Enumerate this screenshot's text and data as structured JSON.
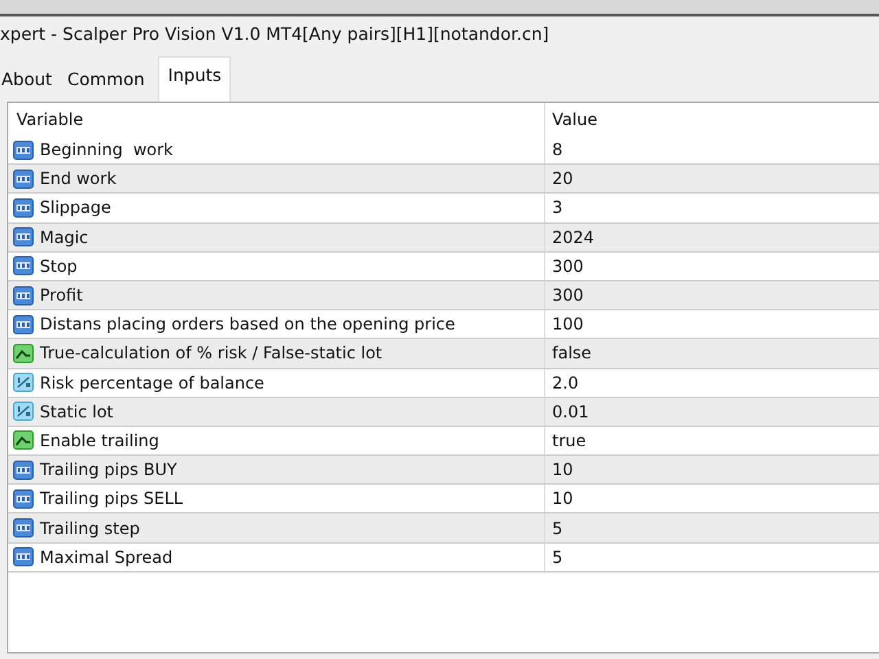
{
  "window": {
    "title": "xpert - Scalper Pro Vision V1.0 MT4[Any pairs][H1][notandor.cn]"
  },
  "tabs": [
    {
      "label": "About",
      "selected": false
    },
    {
      "label": "Common",
      "selected": false
    },
    {
      "label": "Inputs",
      "selected": true
    }
  ],
  "table": {
    "columns": [
      "Variable",
      "Value"
    ],
    "rows": [
      {
        "kind": "int",
        "variable": "Beginning  work",
        "value": "8"
      },
      {
        "kind": "int",
        "variable": "End work",
        "value": "20"
      },
      {
        "kind": "int",
        "variable": "Slippage",
        "value": "3"
      },
      {
        "kind": "int",
        "variable": "Magic",
        "value": "2024"
      },
      {
        "kind": "int",
        "variable": "Stop",
        "value": "300"
      },
      {
        "kind": "int",
        "variable": "Profit",
        "value": "300"
      },
      {
        "kind": "int",
        "variable": "Distans placing orders based on the opening price",
        "value": "100"
      },
      {
        "kind": "bool",
        "variable": "True-calculation of % risk / False-static lot",
        "value": "false"
      },
      {
        "kind": "double",
        "variable": "Risk percentage of balance",
        "value": "2.0"
      },
      {
        "kind": "double",
        "variable": "Static lot",
        "value": "0.01"
      },
      {
        "kind": "bool",
        "variable": "Enable trailing",
        "value": "true"
      },
      {
        "kind": "int",
        "variable": "Trailing pips BUY",
        "value": "10"
      },
      {
        "kind": "int",
        "variable": "Trailing pips SELL",
        "value": "10"
      },
      {
        "kind": "int",
        "variable": "Trailing step",
        "value": "5"
      },
      {
        "kind": "int",
        "variable": "Maximal Spread",
        "value": "5"
      }
    ]
  }
}
